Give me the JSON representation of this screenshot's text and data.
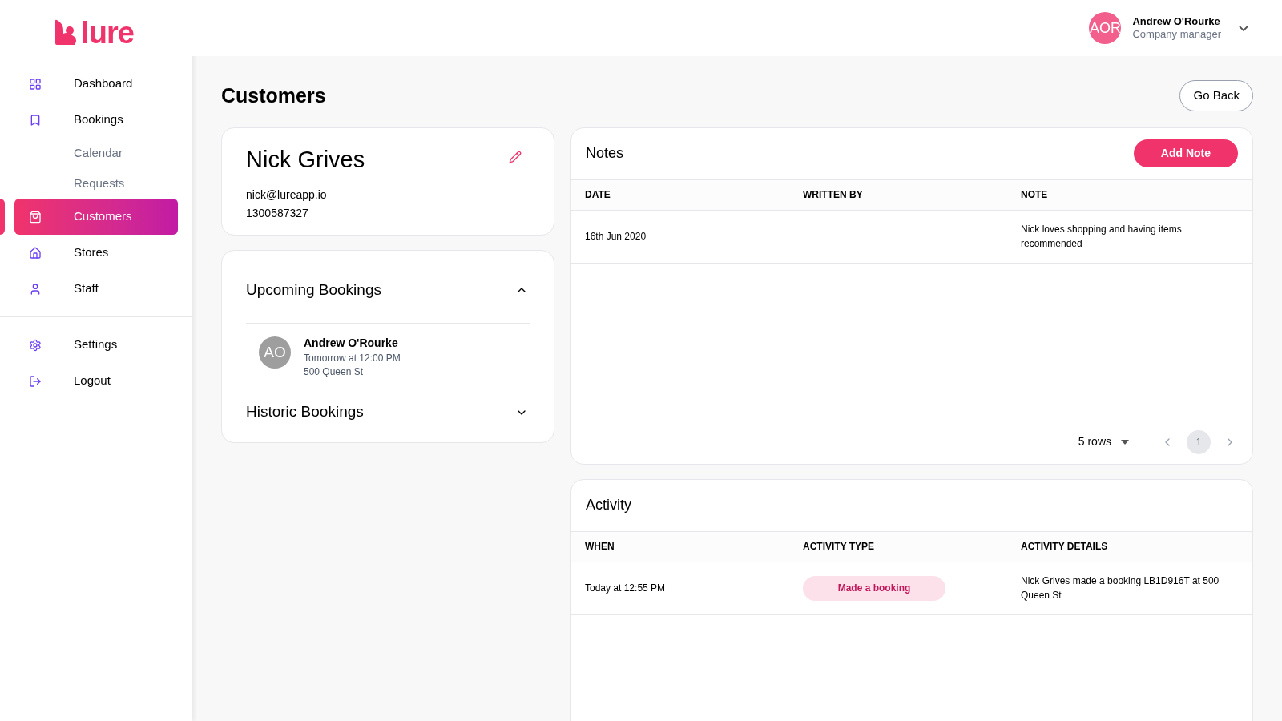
{
  "logo": {
    "text": "lure"
  },
  "nav": [
    {
      "kind": "item",
      "label": "Dashboard",
      "selected": false
    },
    {
      "kind": "item",
      "label": "Bookings",
      "selected": false
    },
    {
      "kind": "subitem",
      "label": "Calendar",
      "selected": false
    },
    {
      "kind": "subitem",
      "label": "Requests",
      "selected": false
    },
    {
      "kind": "item",
      "label": "Customers",
      "selected": true
    },
    {
      "kind": "item",
      "label": "Stores",
      "selected": false
    },
    {
      "kind": "item",
      "label": "Staff",
      "selected": false
    }
  ],
  "nav_bottom": [
    {
      "label": "Settings",
      "selected": false
    },
    {
      "label": "Logout",
      "selected": false
    }
  ],
  "user": {
    "initials": "AOR",
    "name": "Andrew O'Rourke",
    "role": "Company manager"
  },
  "page_title": "Customers",
  "back_button": "Go Back",
  "customer": {
    "name": "Nick Grives",
    "email": "nick@lureapp.io",
    "phone": "1300587327"
  },
  "booking_sections": [
    {
      "title": "Upcoming Bookings",
      "expanded": true,
      "items": [
        {
          "initials": "AO",
          "name": "Andrew O'Rourke",
          "time": "Tomorrow at 12:00 PM",
          "place": "500 Queen St"
        }
      ]
    },
    {
      "title": "Historic Bookings",
      "expanded": false
    }
  ],
  "notes": {
    "title": "Notes",
    "add_button": "Add Note",
    "columns": [
      "DATE",
      "WRITTEN BY",
      "NOTE"
    ],
    "rows": [
      [
        "16th Jun 2020",
        "",
        "Nick loves shopping and having items recommended"
      ]
    ],
    "rows_per_page": "5 rows",
    "pages": [
      {
        "label": "1",
        "selected": true
      }
    ]
  },
  "activity": {
    "title": "Activity",
    "columns": [
      "WHEN",
      "ACTIVITY TYPE",
      "ACTIVITY DETAILS"
    ],
    "rows": [
      {
        "when": "Today at 12:55 PM",
        "type": "Made a booking",
        "details": "Nick Grives made a booking LB1D916T at 500 Queen St"
      }
    ]
  }
}
